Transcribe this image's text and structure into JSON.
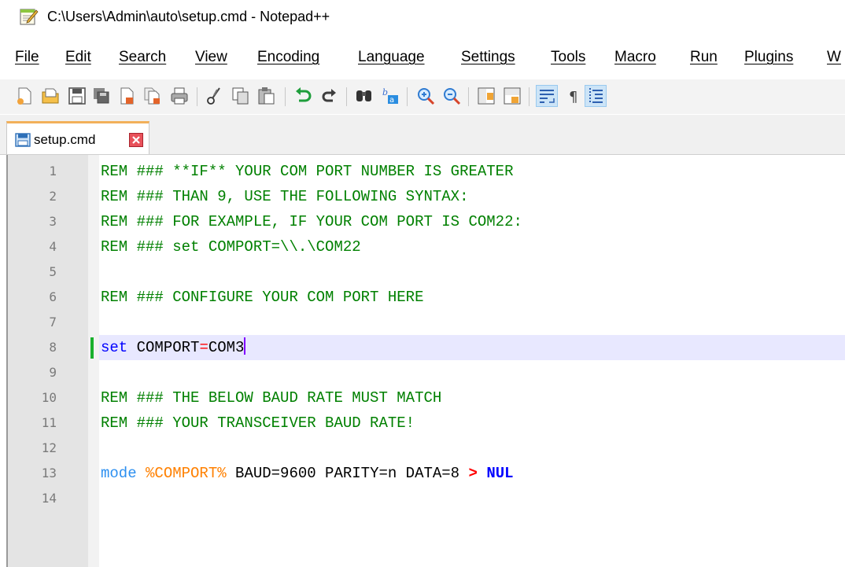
{
  "window": {
    "title": "C:\\Users\\Admin\\auto\\setup.cmd - Notepad++",
    "icon": "notepad-app-icon"
  },
  "menu": [
    {
      "label": "File"
    },
    {
      "label": "Edit"
    },
    {
      "label": "Search"
    },
    {
      "label": "View"
    },
    {
      "label": "Encoding"
    },
    {
      "label": "Language"
    },
    {
      "label": "Settings"
    },
    {
      "label": "Tools"
    },
    {
      "label": "Macro"
    },
    {
      "label": "Run"
    },
    {
      "label": "Plugins"
    },
    {
      "label": "W"
    }
  ],
  "toolbar": {
    "buttons": [
      "new-file-icon",
      "open-file-icon",
      "save-icon",
      "save-all-icon",
      "close-icon",
      "close-all-icon",
      "print-icon",
      "cut-icon",
      "copy-icon",
      "paste-icon",
      "undo-icon",
      "redo-icon",
      "find-icon",
      "replace-icon",
      "zoom-in-icon",
      "zoom-out-icon",
      "sync-vertical-icon",
      "sync-horizontal-icon",
      "word-wrap-icon",
      "show-all-characters-icon",
      "indent-guide-icon"
    ]
  },
  "tabs": [
    {
      "label": "setup.cmd",
      "icon": "saved-file-icon",
      "active": true
    }
  ],
  "editor": {
    "line_numbers": [
      "1",
      "2",
      "3",
      "4",
      "5",
      "6",
      "7",
      "8",
      "9",
      "10",
      "11",
      "12",
      "13",
      "14"
    ],
    "lines": {
      "l1": "REM ### **IF** YOUR COM PORT NUMBER IS GREATER",
      "l2": "REM ### THAN 9, USE THE FOLLOWING SYNTAX:",
      "l3": "REM ### FOR EXAMPLE, IF YOUR COM PORT IS COM22:",
      "l4": "REM ### set COMPORT=\\\\.\\COM22",
      "l6": "REM ### CONFIGURE YOUR COM PORT HERE",
      "l8_kw": "set",
      "l8_var": " COMPORT",
      "l8_eq": "=",
      "l8_val": "COM3",
      "l10": "REM ### THE BELOW BAUD RATE MUST MATCH",
      "l11": "REM ### YOUR TRANSCEIVER BAUD RATE!",
      "l13_kw": "mode",
      "l13_var": "%COMPORT%",
      "l13_args": " BAUD=9600 PARITY=n DATA=8 ",
      "l13_op": ">",
      "l13_nul": "NUL"
    },
    "current_line": 8,
    "colors": {
      "comment": "#008000",
      "keyword": "#0000ff",
      "variable": "#ff8000",
      "operator": "#ff0000",
      "current_line_bg": "#e8e8ff"
    }
  }
}
